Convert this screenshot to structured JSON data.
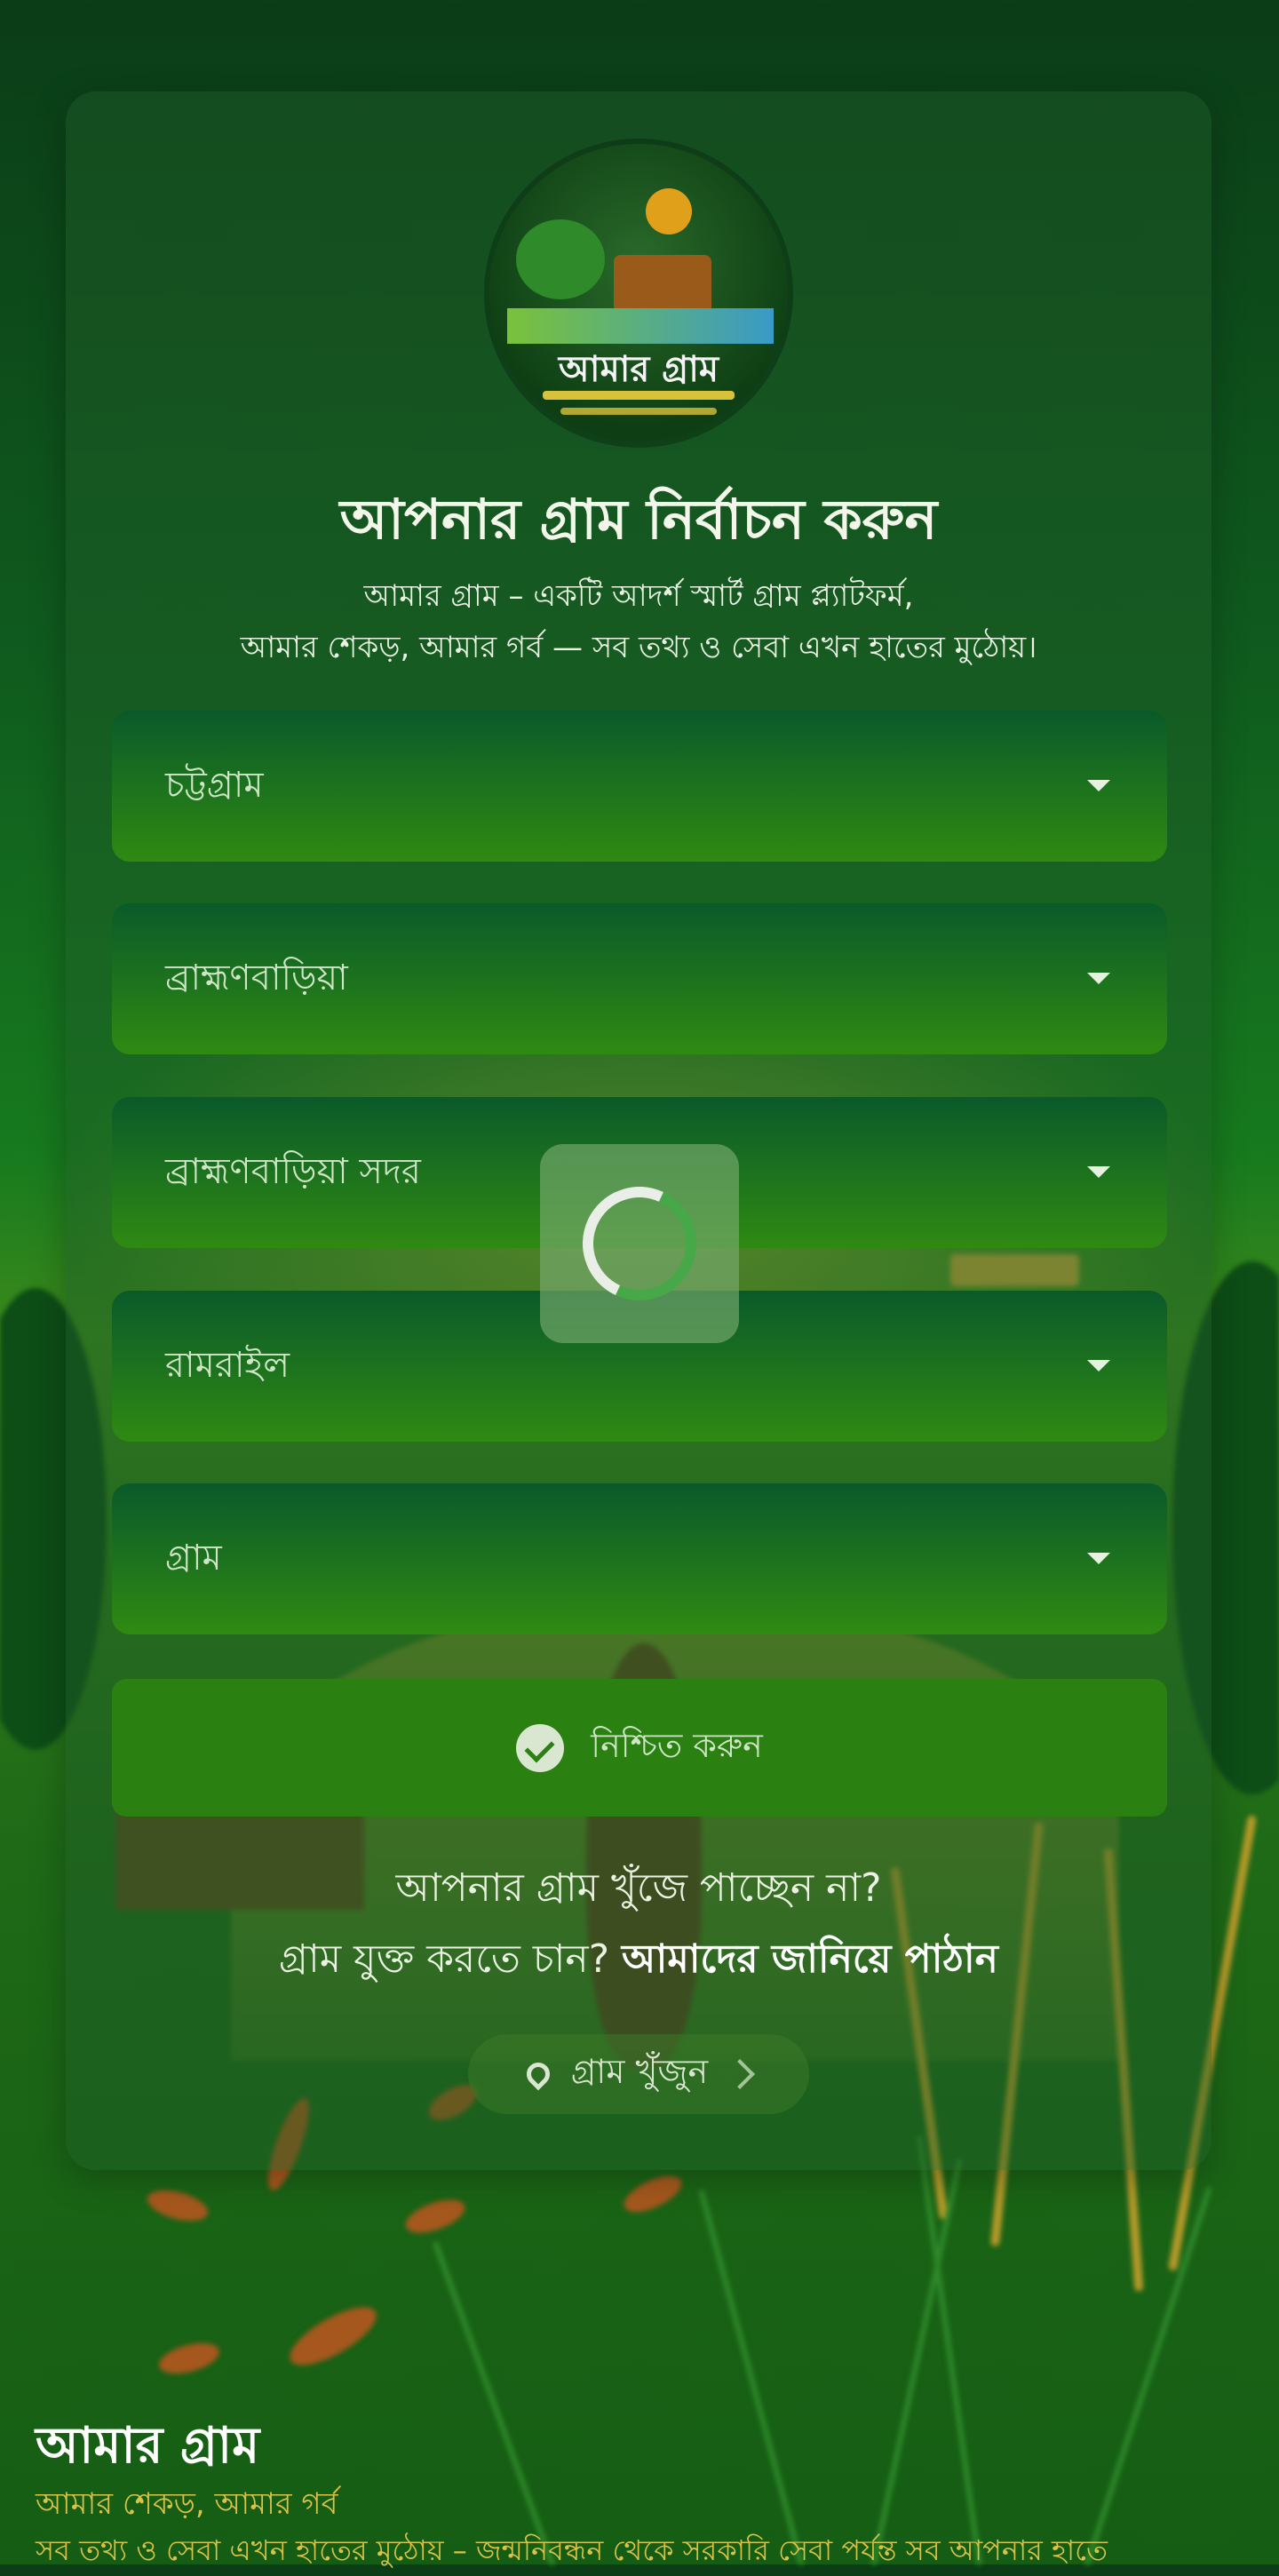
{
  "logo": {
    "title": "আমার গ্রাম"
  },
  "header": {
    "title": "আপনার গ্রাম নির্বাচন করুন",
    "subtitle_line1": "আমার গ্রাম – একটি আদর্শ স্মার্ট গ্রাম প্ল্যাটফর্ম,",
    "subtitle_line2": "আমার শেকড়, আমার গর্ব — সব তথ্য ও সেবা এখন হাতের মুঠোয়।"
  },
  "form": {
    "division": "চট্টগ্রাম",
    "district": "ব্রাহ্মণবাড়িয়া",
    "upazila": "ব্রাহ্মণবাড়িয়া সদর",
    "union": "রামরাইল",
    "village_placeholder": "গ্রাম",
    "confirm_label": "নিশ্চিত করুন"
  },
  "footer_card": {
    "not_found": "আপনার গ্রাম খুঁজে পাচ্ছেন না?",
    "add_prompt": "গ্রাম যুক্ত করতে চান?",
    "add_link": "আমাদের জানিয়ে পাঠান",
    "find_button": "গ্রাম খুঁজুন"
  },
  "site_footer": {
    "brand": "আমার গ্রাম",
    "tagline": "আমার শেকড়, আমার গর্ব",
    "description": "সব তথ্য ও সেবা এখন হাতের মুঠোয় – জন্মনিবন্ধন থেকে সরকারি সেবা পর্যন্ত সব আপনার হাতে"
  },
  "colors": {
    "brand_green": "#2a8010",
    "accent_gold": "#d9c24a"
  },
  "state": {
    "loading": true
  }
}
